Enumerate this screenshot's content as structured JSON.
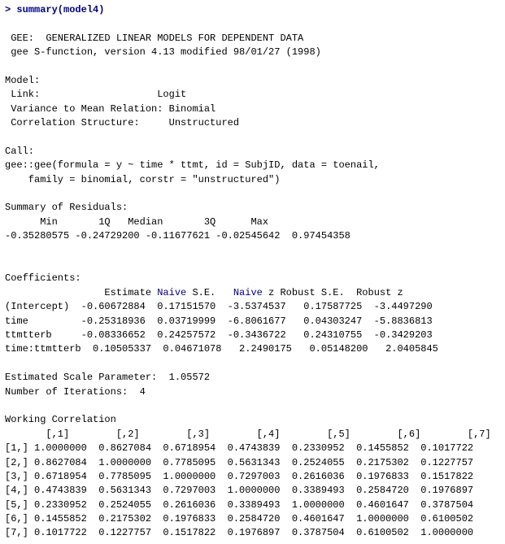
{
  "console": {
    "lines": [
      {
        "id": "prompt",
        "text": "> summary(model4)",
        "type": "prompt"
      },
      {
        "id": "blank1",
        "text": "",
        "type": "blank"
      },
      {
        "id": "gee-title",
        "text": " GEE:  GENERALIZED LINEAR MODELS FOR DEPENDENT DATA",
        "type": "normal"
      },
      {
        "id": "gee-version",
        "text": " gee S-function, version 4.13 modified 98/01/27 (1998)",
        "type": "normal"
      },
      {
        "id": "blank2",
        "text": "",
        "type": "blank"
      },
      {
        "id": "model-header",
        "text": "Model:",
        "type": "normal"
      },
      {
        "id": "link-line",
        "text": " Link:                    Logit",
        "type": "normal"
      },
      {
        "id": "variance-line",
        "text": " Variance to Mean Relation: Binomial",
        "type": "normal"
      },
      {
        "id": "corr-line",
        "text": " Correlation Structure:     Unstructured",
        "type": "normal"
      },
      {
        "id": "blank3",
        "text": "",
        "type": "blank"
      },
      {
        "id": "call-header",
        "text": "Call:",
        "type": "normal"
      },
      {
        "id": "call-line1",
        "text": "gee::gee(formula = y ~ time * ttmt, id = SubjID, data = toenail,",
        "type": "normal"
      },
      {
        "id": "call-line2",
        "text": "    family = binomial, corstr = \"unstructured\")",
        "type": "normal"
      },
      {
        "id": "blank4",
        "text": "",
        "type": "blank"
      },
      {
        "id": "resid-header",
        "text": "Summary of Residuals:",
        "type": "normal"
      },
      {
        "id": "resid-cols",
        "text": "      Min       1Q   Median       3Q      Max",
        "type": "normal"
      },
      {
        "id": "resid-vals",
        "text": "-0.35280575 -0.24729200 -0.11677621 -0.02545642  0.97454358",
        "type": "normal"
      },
      {
        "id": "blank5",
        "text": "",
        "type": "blank"
      },
      {
        "id": "blank6",
        "text": "",
        "type": "blank"
      },
      {
        "id": "coef-header",
        "text": "Coefficients:",
        "type": "normal"
      },
      {
        "id": "coef-cols",
        "text": "                 Estimate Naive S.E.   Naive z Robust S.E.  Robust z",
        "type": "normal"
      },
      {
        "id": "coef-intercept",
        "text": "(Intercept)  -0.60672884  0.17151570  -3.5374537   0.17587725  -3.4497290",
        "type": "normal"
      },
      {
        "id": "coef-time",
        "text": "time         -0.25318936  0.03719999  -6.8061677   0.04303247  -5.8836813",
        "type": "normal"
      },
      {
        "id": "coef-ttmt",
        "text": "ttmtterb     -0.08336652  0.24257572  -0.3436722   0.24310755  -0.3429203",
        "type": "normal"
      },
      {
        "id": "coef-interact",
        "text": "time:ttmtterb  0.10505337  0.04671078   2.2490175   0.05148200   2.0405845",
        "type": "normal"
      },
      {
        "id": "blank7",
        "text": "",
        "type": "blank"
      },
      {
        "id": "scale-param",
        "text": "Estimated Scale Parameter:  1.05572",
        "type": "normal"
      },
      {
        "id": "iterations",
        "text": "Number of Iterations:  4",
        "type": "normal"
      },
      {
        "id": "blank8",
        "text": "",
        "type": "blank"
      },
      {
        "id": "wc-header",
        "text": "Working Correlation",
        "type": "normal"
      },
      {
        "id": "wc-cols",
        "text": "       [,1]        [,2]        [,3]        [,4]        [,5]        [,6]        [,7]",
        "type": "normal"
      },
      {
        "id": "wc-r1",
        "text": "[1,] 1.0000000  0.8627084  0.6718954  0.4743839  0.2330952  0.1455852  0.1017722",
        "type": "normal"
      },
      {
        "id": "wc-r2",
        "text": "[2,] 0.8627084  1.0000000  0.7785095  0.5631343  0.2524055  0.2175302  0.1227757",
        "type": "normal"
      },
      {
        "id": "wc-r3",
        "text": "[3,] 0.6718954  0.7785095  1.0000000  0.7297003  0.2616036  0.1976833  0.1517822",
        "type": "normal"
      },
      {
        "id": "wc-r4",
        "text": "[4,] 0.4743839  0.5631343  0.7297003  1.0000000  0.3389493  0.2584720  0.1976897",
        "type": "normal"
      },
      {
        "id": "wc-r5",
        "text": "[5,] 0.2330952  0.2524055  0.2616036  0.3389493  1.0000000  0.4601647  0.3787504",
        "type": "normal"
      },
      {
        "id": "wc-r6",
        "text": "[6,] 0.1455852  0.2175302  0.1976833  0.2584720  0.4601647  1.0000000  0.6100502",
        "type": "normal"
      },
      {
        "id": "wc-r7",
        "text": "[7,] 0.1017722  0.1227757  0.1517822  0.1976897  0.3787504  0.6100502  1.0000000",
        "type": "normal"
      }
    ]
  }
}
